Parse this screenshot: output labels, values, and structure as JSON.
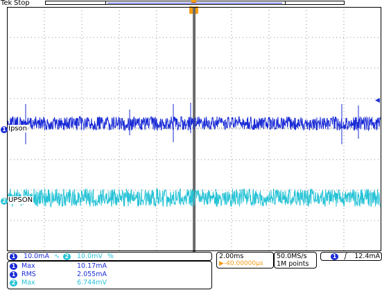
{
  "header": {
    "brand": "Tek",
    "status": "Stop"
  },
  "colors": {
    "ch1": "#1a2bd6",
    "ch2": "#27c3d6",
    "trigger": "#f39c12"
  },
  "trigger_marker": {
    "label": "T"
  },
  "channels": [
    {
      "number": "1",
      "label": "Ipson"
    },
    {
      "number": "2",
      "label": "UPSON"
    }
  ],
  "channel_settings": {
    "ch1_number": "1",
    "ch1_scale": "10.0mA",
    "ch2_number": "2",
    "ch2_scale": "10.0mV",
    "ch2_bw_symbol": "%"
  },
  "measurements": [
    {
      "channel": "1",
      "name": "Max",
      "value": "10.17mA"
    },
    {
      "channel": "1",
      "name": "RMS",
      "value": "2.055mA"
    },
    {
      "channel": "2",
      "name": "Max",
      "value": "6.744mV"
    }
  ],
  "timebase": {
    "scale": "2.00ms",
    "position": "▶-40.00000μs"
  },
  "acquisition": {
    "rate": "50.0MS/s",
    "record": "1M points"
  },
  "trigger": {
    "channel": "1",
    "slope": "ʃ",
    "level": "12.4mA"
  }
}
